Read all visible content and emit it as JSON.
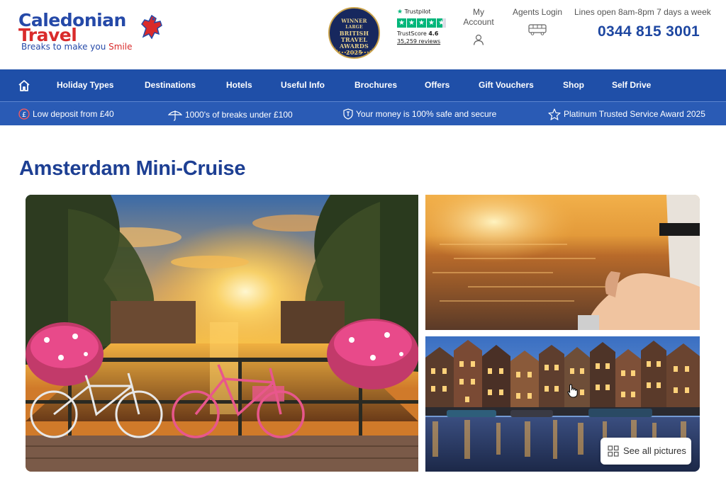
{
  "header": {
    "logo": {
      "line1": "Caledonian",
      "line2": "Travel",
      "tagline_prefix": "Breaks to make you ",
      "tagline_highlight": "Smile"
    },
    "award": {
      "lines": [
        "WINNER",
        "LARGE",
        "BRITISH",
        "TRAVEL",
        "AWARDS",
        "2025"
      ]
    },
    "trustpilot": {
      "brand": "Trustpilot",
      "score_label": "TrustScore",
      "score": "4.6",
      "reviews": "35,259 reviews"
    },
    "my_account": "My Account",
    "agents_login": "Agents Login",
    "lines_open": "Lines open 8am-8pm 7 days a week",
    "phone": "0344 815 3001"
  },
  "nav": {
    "items": [
      {
        "label": "Holiday Types"
      },
      {
        "label": "Destinations"
      },
      {
        "label": "Hotels"
      },
      {
        "label": "Useful Info"
      },
      {
        "label": "Brochures"
      },
      {
        "label": "Offers"
      },
      {
        "label": "Gift Vouchers"
      },
      {
        "label": "Shop"
      },
      {
        "label": "Self Drive"
      }
    ]
  },
  "usp": {
    "items": [
      {
        "text": "Low deposit from £40",
        "icon": "pound-icon"
      },
      {
        "text": "1000's of breaks under £100",
        "icon": "umbrella-icon"
      },
      {
        "text": "Your money is 100% safe and secure",
        "icon": "shield-icon"
      },
      {
        "text": "Platinum Trusted Service Award 2025",
        "icon": "star-icon"
      }
    ]
  },
  "page": {
    "title": "Amsterdam Mini-Cruise",
    "see_all": "See all pictures"
  },
  "colors": {
    "brand_blue": "#1f4fa8",
    "usp_blue": "#2a5bb5",
    "title_blue": "#1d3f93",
    "brand_red": "#d92b2b",
    "trustpilot_green": "#00b67a"
  }
}
